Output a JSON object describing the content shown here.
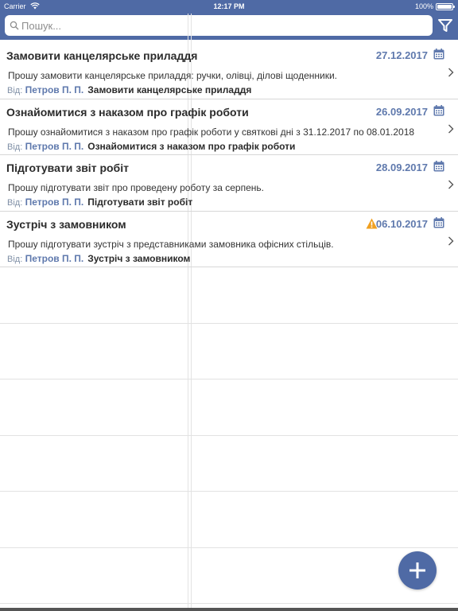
{
  "status_bar": {
    "carrier": "Carrier",
    "time": "12:17 PM",
    "battery_percent": "100%"
  },
  "search": {
    "placeholder": "Пошук..."
  },
  "colors": {
    "accent": "#4f6aa5",
    "date": "#5f79ad",
    "warning": "#f0a020"
  },
  "icons": [
    "wifi-icon",
    "battery-icon",
    "search-icon",
    "filter-icon",
    "calendar-icon",
    "warning-icon",
    "chevron-right-icon",
    "plus-icon"
  ],
  "tasks": [
    {
      "title": "Замовити канцелярське приладдя",
      "date": "27.12.2017",
      "description": "Прошу замовити канцелярське приладдя: ручки, олівці, ділові щоденники.",
      "from_label": "Від:",
      "from_name": "Петров П. П.",
      "subject": "Замовити канцелярське приладдя",
      "warning": false
    },
    {
      "title": "Ознайомитися з наказом про графік роботи",
      "date": "26.09.2017",
      "description": "Прошу ознайомитися з наказом про графік роботи у святкові дні з 31.12.2017 по 08.01.2018",
      "from_label": "Від:",
      "from_name": "Петров П. П.",
      "subject": "Ознайомитися з наказом про графік роботи",
      "warning": false
    },
    {
      "title": "Підготувати звіт робіт",
      "date": "28.09.2017",
      "description": "Прошу підготувати звіт про проведену роботу за серпень.",
      "from_label": "Від:",
      "from_name": "Петров П. П.",
      "subject": "Підготувати звіт робіт",
      "warning": false
    },
    {
      "title": "Зустріч з замовником",
      "date": "06.10.2017",
      "description": "Прошу підготувати зустріч з представниками замовника офісних стільців.",
      "from_label": "Від:",
      "from_name": "Петров П. П.",
      "subject": "Зустріч з замовником",
      "warning": true
    }
  ]
}
